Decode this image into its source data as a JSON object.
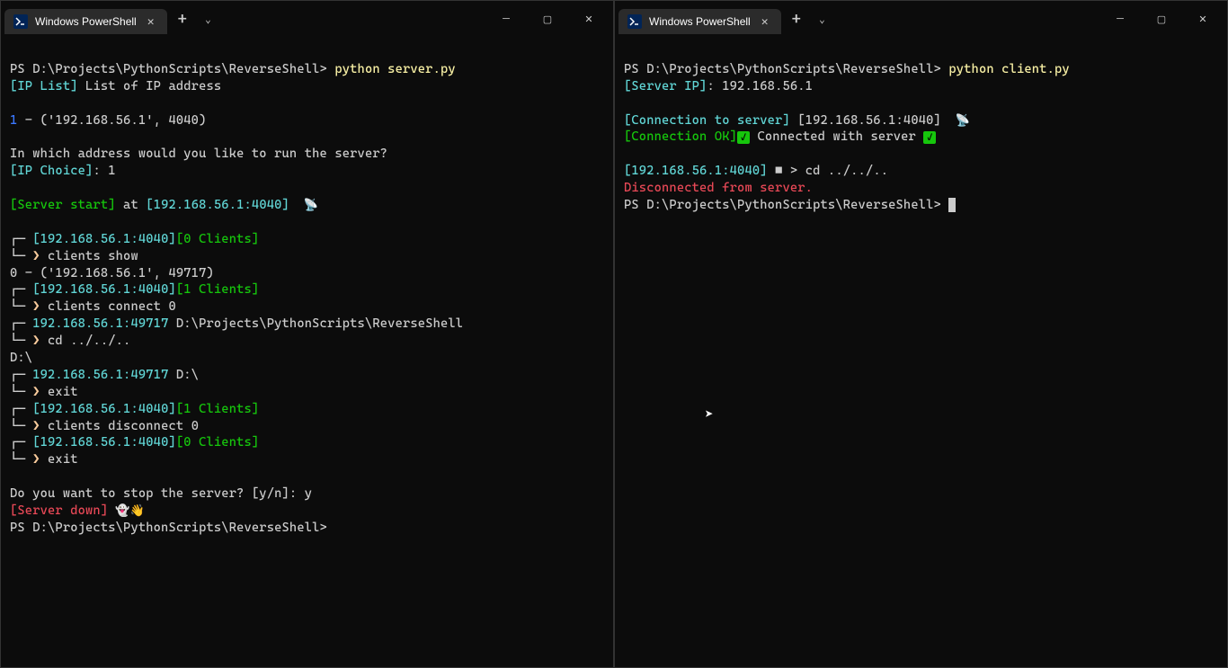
{
  "left": {
    "tab_title": "Windows PowerShell",
    "lines": {
      "l1_prompt": "PS D:\\Projects\\PythonScripts\\ReverseShell> ",
      "l1_cmd": "python server.py",
      "l2_tag": "[IP List]",
      "l2_text": " List of IP address",
      "l3_num": "1",
      "l3_rest": " - ('192.168.56.1', 4040)",
      "l4": "In which address would you like to run the server?",
      "l5_tag": "[IP Choice]",
      "l5_colon": ": ",
      "l5_val": "1",
      "l6_tag": "[Server start]",
      "l6_at": " at ",
      "l6_addr": "[192.168.56.1:4040]",
      "l6_emoji": "  📡",
      "prompt1_addr": "[192.168.56.1:4040]",
      "prompt1_clients": "[0 Clients]",
      "prompt1_cmd": "clients show",
      "clientline": "0 - ('192.168.56.1', 49717)",
      "prompt2_clients": "[1 Clients]",
      "prompt2_cmd": "clients connect 0",
      "conn_addr": "192.168.56.1:49717",
      "conn_path": " D:\\Projects\\PythonScripts\\ReverseShell",
      "conn_cmd": "cd ../../..",
      "cd_result": "D:\\",
      "conn2_path": " D:\\",
      "conn2_cmd": "exit",
      "prompt3_cmd": "clients disconnect 0",
      "prompt4_clients": "[0 Clients]",
      "prompt4_cmd": "exit",
      "stop_q": "Do you want to stop the server? [y/n]: y",
      "server_down": "[Server down]",
      "down_emoji": " 👻👋",
      "final_prompt": "PS D:\\Projects\\PythonScripts\\ReverseShell>"
    }
  },
  "right": {
    "tab_title": "Windows PowerShell",
    "lines": {
      "l1_prompt": "PS D:\\Projects\\PythonScripts\\ReverseShell> ",
      "l1_cmd": "python client.py",
      "l2_tag": "[Server IP]",
      "l2_colon": ": ",
      "l2_val": "192.168.56.1",
      "l3_tag": "[Connection to server]",
      "l3_addr": " [192.168.56.1:4040]",
      "l3_emoji": "  📡",
      "l4_tag": "[Connection OK]",
      "l4_text": " Connected with server ",
      "l5_addr": "[192.168.56.1:4040]",
      "l5_icon": " ■ ",
      "l5_gt": "> ",
      "l5_cmd": "cd ../../..",
      "disc": "Disconnected from server.",
      "final_prompt": "PS D:\\Projects\\PythonScripts\\ReverseShell> "
    }
  }
}
